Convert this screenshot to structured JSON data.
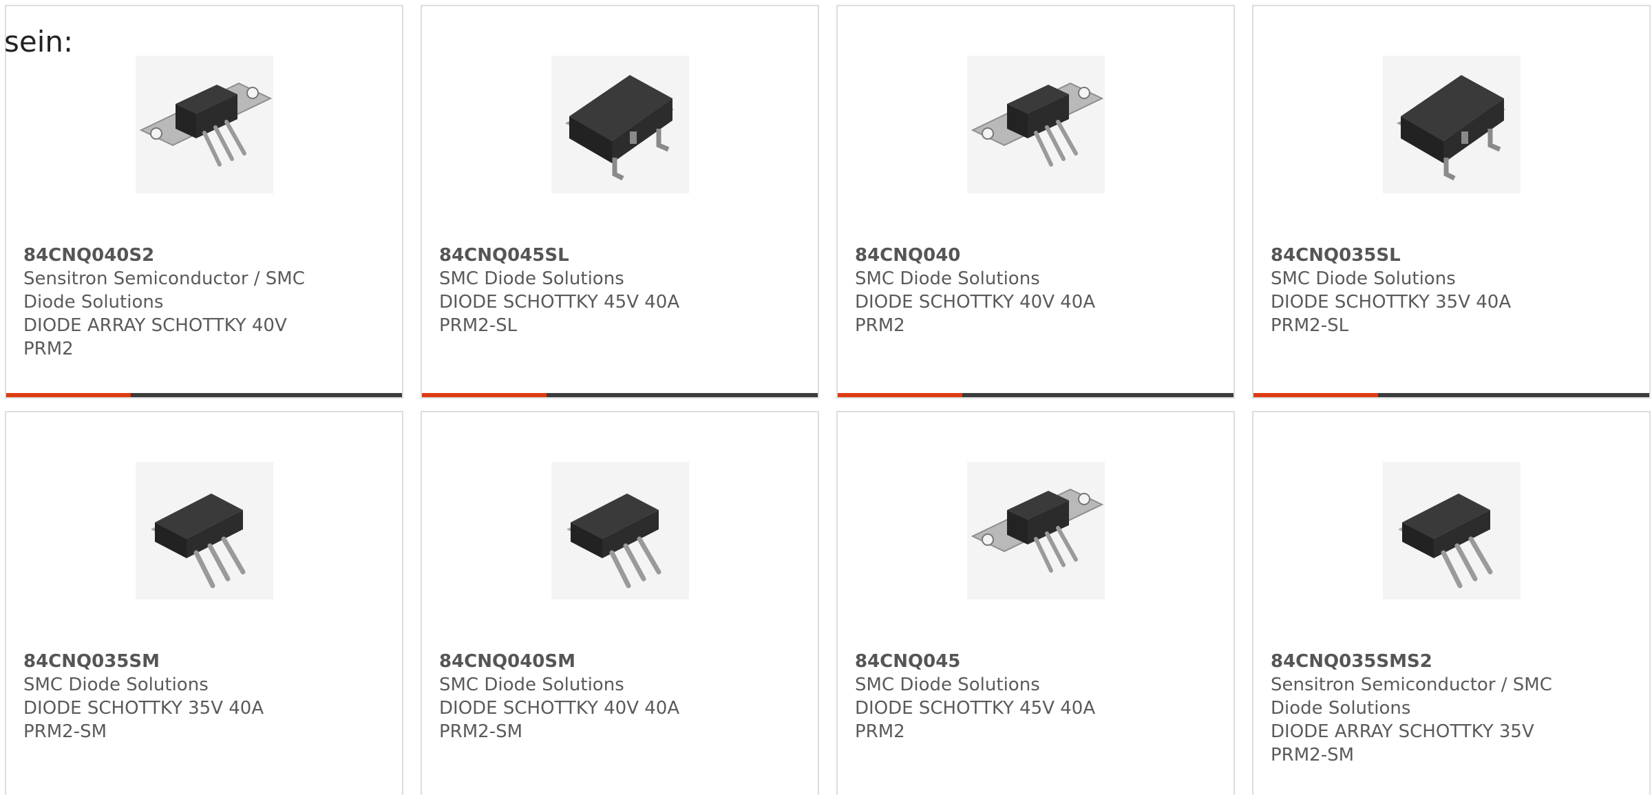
{
  "leading_text": "sein:",
  "colors": {
    "accent": "#de3b12",
    "bar": "#3c3c3c",
    "border": "#dddddd",
    "text": "#5a5a5a"
  },
  "products": [
    {
      "part_number": "84CNQ040S2",
      "manufacturer": "Sensitron Semiconductor / SMC Diode Solutions",
      "description": "DIODE ARRAY SCHOTTKY 40V PRM2",
      "image_icon": "tab-package-icon"
    },
    {
      "part_number": "84CNQ045SL",
      "manufacturer": "SMC Diode Solutions",
      "description": "DIODE SCHOTTKY 45V 40A PRM2-SL",
      "image_icon": "smd-package-icon"
    },
    {
      "part_number": "84CNQ040",
      "manufacturer": "SMC Diode Solutions",
      "description": "DIODE SCHOTTKY 40V 40A PRM2",
      "image_icon": "tab-package-icon"
    },
    {
      "part_number": "84CNQ035SL",
      "manufacturer": "SMC Diode Solutions",
      "description": "DIODE SCHOTTKY 35V 40A PRM2-SL",
      "image_icon": "smd-package-icon"
    },
    {
      "part_number": "84CNQ035SM",
      "manufacturer": "SMC Diode Solutions",
      "description": "DIODE SCHOTTKY 35V 40A PRM2-SM",
      "image_icon": "through-hole-package-icon"
    },
    {
      "part_number": "84CNQ040SM",
      "manufacturer": "SMC Diode Solutions",
      "description": "DIODE SCHOTTKY 40V 40A PRM2-SM",
      "image_icon": "through-hole-package-icon"
    },
    {
      "part_number": "84CNQ045",
      "manufacturer": "SMC Diode Solutions",
      "description": "DIODE SCHOTTKY 45V 40A PRM2",
      "image_icon": "tab-package-icon"
    },
    {
      "part_number": "84CNQ035SMS2",
      "manufacturer": "Sensitron Semiconductor / SMC Diode Solutions",
      "description": "DIODE ARRAY SCHOTTKY 35V PRM2-SM",
      "image_icon": "through-hole-package-icon"
    }
  ]
}
